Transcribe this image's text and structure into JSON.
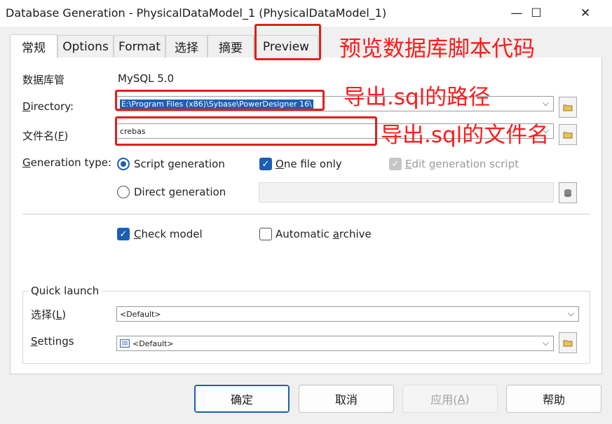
{
  "window": {
    "title": "Database Generation - PhysicalDataModel_1 (PhysicalDataModel_1)",
    "minimize": "—",
    "maximize": "☐",
    "close": "✕"
  },
  "tabs": [
    "常规",
    "Options",
    "Format",
    "选择",
    "摘要",
    "Preview"
  ],
  "general": {
    "dbms_label": "数据库管",
    "dbms_value": "MySQL 5.0",
    "directory_label_u": "D",
    "directory_label_rest": "irectory:",
    "directory_value": "E:\\Program Files (x86)\\Sybase\\PowerDesigner 16\\",
    "filename_label": "文件名(",
    "filename_label_u": "F",
    "filename_label_end": ")",
    "filename_value": "crebas",
    "gentype_label_u": "G",
    "gentype_label_rest": "eneration type:",
    "script_generation": "Script generation",
    "direct_generation": "Direct generation",
    "one_file_only_u": "O",
    "one_file_only_rest": "ne file only",
    "edit_script_u": "E",
    "edit_script_rest": "dit generation script",
    "check_model_u": "C",
    "check_model_rest": "heck model",
    "auto_archive_a": "Automatic ",
    "auto_archive_u": "a",
    "auto_archive_rest": "rchive"
  },
  "quick_launch": {
    "group_label": "Quick launch",
    "select_label": "选择(",
    "select_label_u": "L",
    "select_label_end": ")",
    "select_value": "<Default>",
    "settings_label_u": "S",
    "settings_label_rest": "ettings",
    "settings_value": "<Default>"
  },
  "buttons": {
    "ok": "确定",
    "cancel": "取消",
    "apply_a": "应用(",
    "apply_u": "A",
    "apply_end": ")",
    "help": "帮助"
  },
  "annotations": {
    "preview": "预览数据库脚本代码",
    "directory": "导出.sql的路径",
    "filename": "导出.sql的文件名"
  },
  "colors": {
    "accent": "#1a5fb4",
    "annotation": "#e02020"
  },
  "icons": {
    "chevron": "⌵",
    "folder": "folder-icon",
    "db": "database-icon",
    "settings": "settings-icon"
  }
}
